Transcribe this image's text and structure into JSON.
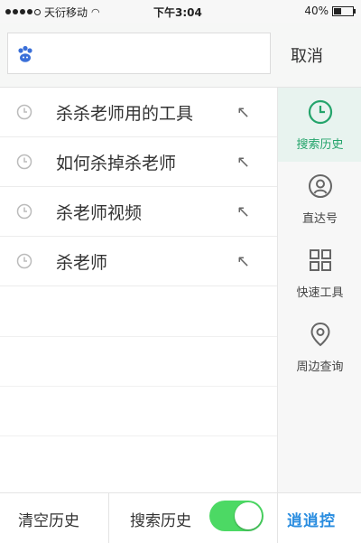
{
  "status_bar": {
    "carrier": "天衍移动",
    "time": "下午3:04",
    "battery_text": "40%",
    "battery_level": 0.4
  },
  "search": {
    "query": "",
    "cancel_label": "取消"
  },
  "history": {
    "items": [
      {
        "text": "杀杀老师用的工具"
      },
      {
        "text": "如何杀掉杀老师"
      },
      {
        "text": "杀老师视频"
      },
      {
        "text": "杀老师"
      }
    ]
  },
  "sidebar": {
    "items": [
      {
        "label": "搜索历史",
        "icon": "clock-icon",
        "active": true
      },
      {
        "label": "直达号",
        "icon": "person-circle-icon",
        "active": false
      },
      {
        "label": "快速工具",
        "icon": "grid-icon",
        "active": false
      },
      {
        "label": "周边查询",
        "icon": "location-pin-icon",
        "active": false
      }
    ]
  },
  "bottom_bar": {
    "clear_label": "清空历史",
    "history_toggle_label": "搜索历史",
    "history_toggle_on": true,
    "brand_text": "逍逍控"
  },
  "colors": {
    "accent_green": "#24a46b",
    "toggle_green": "#4cd964",
    "brand_blue": "#2a8de0"
  }
}
